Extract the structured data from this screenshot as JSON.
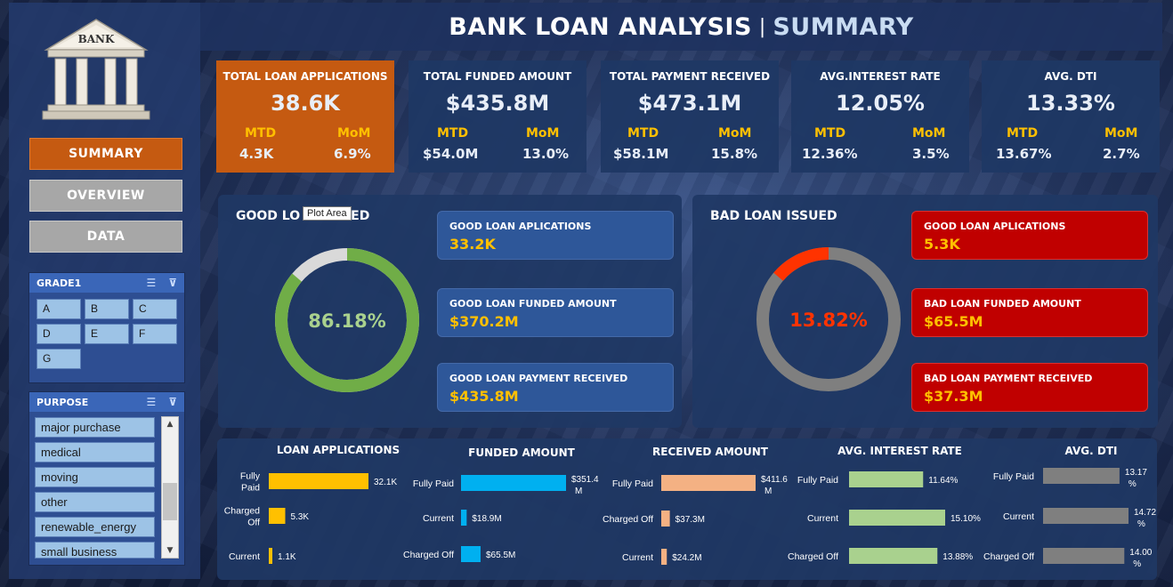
{
  "header": {
    "title": "BANK LOAN ANALYSIS",
    "separator": "|",
    "subtitle": "SUMMARY"
  },
  "logo": {
    "text": "BANK",
    "icon": "bank-building-icon"
  },
  "nav": {
    "summary": "SUMMARY",
    "overview": "OVERVIEW",
    "data": "DATA"
  },
  "grade_slicer": {
    "title": "GRADE1",
    "items": [
      "A",
      "B",
      "C",
      "D",
      "E",
      "F",
      "G"
    ]
  },
  "purpose_slicer": {
    "title": "PURPOSE",
    "items": [
      "major purchase",
      "medical",
      "moving",
      "other",
      "renewable_energy",
      "small business"
    ]
  },
  "kpis": [
    {
      "title": "TOTAL LOAN APPLICATIONS",
      "value": "38.6K",
      "mtd_label": "MTD",
      "mtd": "4.3K",
      "mom_label": "MoM",
      "mom": "6.9%"
    },
    {
      "title": "TOTAL FUNDED AMOUNT",
      "value": "$435.8M",
      "mtd_label": "MTD",
      "mtd": "$54.0M",
      "mom_label": "MoM",
      "mom": "13.0%"
    },
    {
      "title": "TOTAL PAYMENT RECEIVED",
      "value": "$473.1M",
      "mtd_label": "MTD",
      "mtd": "$58.1M",
      "mom_label": "MoM",
      "mom": "15.8%"
    },
    {
      "title": "AVG.INTEREST RATE",
      "value": "12.05%",
      "mtd_label": "MTD",
      "mtd": "12.36%",
      "mom_label": "MoM",
      "mom": "3.5%"
    },
    {
      "title": "AVG. DTI",
      "value": "13.33%",
      "mtd_label": "MTD",
      "mtd": "13.67%",
      "mom_label": "MoM",
      "mom": "2.7%"
    }
  ],
  "good_loan": {
    "title_left": "GOOD LO",
    "title_right": "ED",
    "tooltip": "Plot Area",
    "percent": 86.18,
    "percent_label": "86.18%",
    "cards": [
      {
        "title": "GOOD LOAN APLICATIONS",
        "value": "33.2K"
      },
      {
        "title": "GOOD LOAN FUNDED AMOUNT",
        "value": "$370.2M"
      },
      {
        "title": "GOOD LOAN PAYMENT RECEIVED",
        "value": "$435.8M"
      }
    ],
    "colors": {
      "ring": "#70ad47",
      "rest": "#d9d9d9",
      "label": "#a9d18e"
    }
  },
  "bad_loan": {
    "title": "BAD LOAN ISSUED",
    "percent": 13.82,
    "percent_label": "13.82%",
    "cards": [
      {
        "title": "GOOD LOAN APLICATIONS",
        "value": "5.3K"
      },
      {
        "title": "BAD LOAN FUNDED AMOUNT",
        "value": "$65.5M"
      },
      {
        "title": "BAD LOAN PAYMENT RECEIVED",
        "value": "$37.3M"
      }
    ],
    "colors": {
      "ring": "#ff3300",
      "rest": "#7f7f7f",
      "label": "#ff3300"
    }
  },
  "chart_data": [
    {
      "type": "bar",
      "title": "LOAN APPLICATIONS",
      "categories": [
        "Fully Paid",
        "Charged Off",
        "Current"
      ],
      "values": [
        32.1,
        5.3,
        1.1
      ],
      "labels": [
        "32.1K",
        "5.3K",
        "1.1K"
      ],
      "color": "#ffc000"
    },
    {
      "type": "bar",
      "title": "FUNDED AMOUNT",
      "categories": [
        "Fully Paid",
        "Current",
        "Charged Off"
      ],
      "values": [
        351.4,
        18.9,
        65.5
      ],
      "labels": [
        "$351.4 M",
        "$18.9M",
        "$65.5M"
      ],
      "color": "#00b0f0"
    },
    {
      "type": "bar",
      "title": "RECEIVED AMOUNT",
      "categories": [
        "Fully Paid",
        "Charged Off",
        "Current"
      ],
      "values": [
        411.6,
        37.3,
        24.2
      ],
      "labels": [
        "$411.6 M",
        "$37.3M",
        "$24.2M"
      ],
      "color": "#f4b183"
    },
    {
      "type": "bar",
      "title": "AVG. INTEREST RATE",
      "categories": [
        "Fully Paid",
        "Current",
        "Charged Off"
      ],
      "values": [
        11.64,
        15.1,
        13.88
      ],
      "labels": [
        "11.64%",
        "15.10%",
        "13.88%"
      ],
      "color": "#a9d18e"
    },
    {
      "type": "bar",
      "title": "AVG. DTI",
      "categories": [
        "Fully Paid",
        "Current",
        "Charged Off"
      ],
      "values": [
        13.17,
        14.72,
        14.0
      ],
      "labels": [
        "13.17 %",
        "14.72 %",
        "14.00 %"
      ],
      "color": "#7f7f7f"
    }
  ]
}
